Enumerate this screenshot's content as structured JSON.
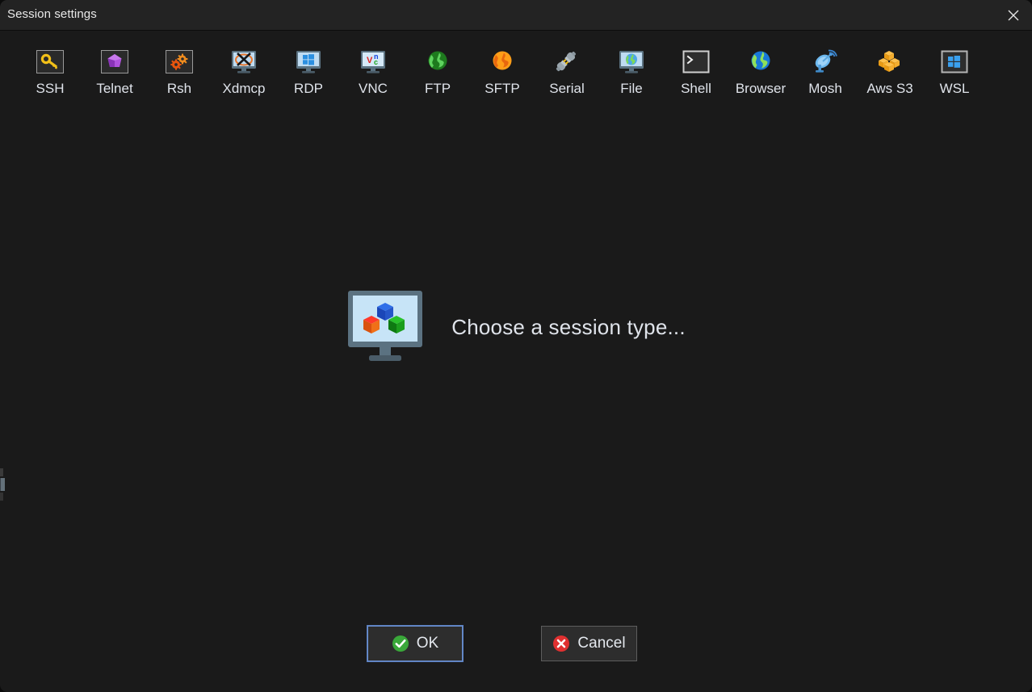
{
  "window": {
    "title": "Session settings",
    "close_icon": "close-icon"
  },
  "toolbar": {
    "items": [
      {
        "label": "SSH",
        "icon": "key-icon"
      },
      {
        "label": "Telnet",
        "icon": "gem-icon"
      },
      {
        "label": "Rsh",
        "icon": "gears-icon"
      },
      {
        "label": "Xdmcp",
        "icon": "x11-monitor-icon"
      },
      {
        "label": "RDP",
        "icon": "windows-monitor-icon"
      },
      {
        "label": "VNC",
        "icon": "vnc-monitor-icon"
      },
      {
        "label": "FTP",
        "icon": "green-globe-icon"
      },
      {
        "label": "SFTP",
        "icon": "orange-globe-icon"
      },
      {
        "label": "Serial",
        "icon": "plug-connector-icon"
      },
      {
        "label": "File",
        "icon": "file-monitor-globe-icon"
      },
      {
        "label": "Shell",
        "icon": "terminal-prompt-icon"
      },
      {
        "label": "Browser",
        "icon": "earth-globe-icon"
      },
      {
        "label": "Mosh",
        "icon": "satellite-dish-icon"
      },
      {
        "label": "Aws S3",
        "icon": "aws-cubes-icon"
      },
      {
        "label": "WSL",
        "icon": "windows-box-icon"
      }
    ]
  },
  "main": {
    "placeholder_text": "Choose a session type...",
    "placeholder_icon": "monitor-cubes-icon"
  },
  "footer": {
    "ok_label": "OK",
    "ok_icon": "green-check-icon",
    "cancel_label": "Cancel",
    "cancel_icon": "red-cross-icon"
  },
  "colors": {
    "window_bg": "#1a1a1a",
    "titlebar_bg": "#232323",
    "text": "#dfe3ea",
    "focus_border": "#6a8ecb",
    "ok_green": "#3aa83a",
    "cancel_red": "#e03030"
  }
}
